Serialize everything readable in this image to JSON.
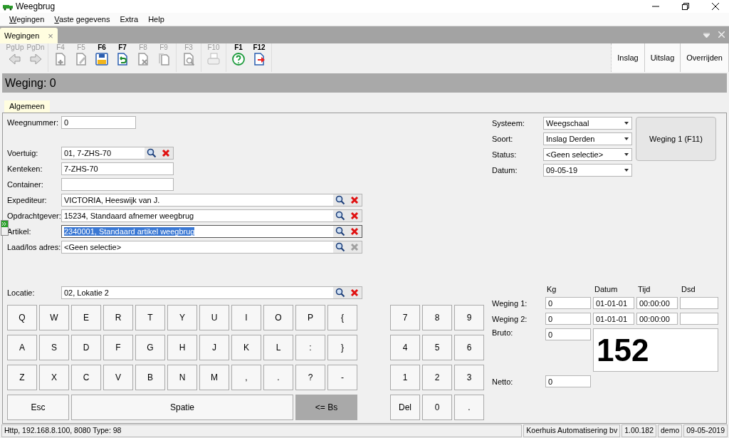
{
  "window": {
    "title": "Weegbrug"
  },
  "menu": [
    {
      "label": "Wegingen",
      "underline_first": true
    },
    {
      "label": "Vaste gegevens",
      "underline_first": true
    },
    {
      "label": "Extra",
      "underline_first": false
    },
    {
      "label": "Help",
      "underline_first": false
    }
  ],
  "document_tab": {
    "label": "Wegingen",
    "close": "×"
  },
  "toolbar": {
    "groups": [
      [
        {
          "key": "PgUp",
          "enabled": false
        },
        {
          "key": "PgDn",
          "enabled": false
        }
      ],
      [
        {
          "key": "F4",
          "enabled": false
        },
        {
          "key": "F5",
          "enabled": false
        },
        {
          "key": "F6",
          "enabled": true
        },
        {
          "key": "F7",
          "enabled": true
        },
        {
          "key": "F8",
          "enabled": false
        },
        {
          "key": "F9",
          "enabled": false
        }
      ],
      [
        {
          "key": "F3",
          "enabled": false
        }
      ],
      [
        {
          "key": "F10",
          "enabled": false
        }
      ],
      [
        {
          "key": "F1",
          "enabled": true
        },
        {
          "key": "F12",
          "enabled": true
        }
      ]
    ],
    "actions": [
      "Inslag",
      "Uitslag",
      "Overrijden"
    ]
  },
  "header": "Weging: 0",
  "tabs": [
    {
      "label": "Algemeen",
      "selected": true
    }
  ],
  "fields": [
    {
      "label": "Weegnummer:",
      "value": "0",
      "kind": "text"
    },
    {
      "label": "Voertuig:",
      "value": "01, 7-ZHS-70",
      "kind": "lookup",
      "clear_enabled": true,
      "selected": false
    },
    {
      "label": "Kenteken:",
      "value": "7-ZHS-70",
      "kind": "text"
    },
    {
      "label": "Container:",
      "kind": "text"
    },
    {
      "label": "Expediteur:",
      "value": "VICTORIA, Heeswijk van J.",
      "kind": "lookup",
      "clear_enabled": true,
      "selected": false
    },
    {
      "label": "Opdrachtgever:",
      "value": "15234, Standaard afnemer weegbrug",
      "kind": "lookup",
      "clear_enabled": true,
      "selected": false
    },
    {
      "label": "Artikel:",
      "value": "2340001, Standaard artikel weegbrug",
      "kind": "lookup",
      "clear_enabled": true,
      "selected": true
    },
    {
      "label": "Laad/los adres:",
      "value": "<Geen selectie>",
      "kind": "lookup",
      "clear_enabled": false,
      "selected": false
    }
  ],
  "location_field": {
    "label": "Locatie:",
    "value": "02, Lokatie 2",
    "clear_enabled": true,
    "selected": false
  },
  "keyboard": {
    "letter_rows": [
      [
        "Q",
        "W",
        "E",
        "R",
        "T",
        "Y",
        "U",
        "I",
        "O",
        "P",
        "{"
      ],
      [
        "A",
        "S",
        "D",
        "F",
        "G",
        "H",
        "J",
        "K",
        "L",
        ":",
        "}"
      ],
      [
        "Z",
        "X",
        "C",
        "V",
        "B",
        "N",
        "M",
        ",",
        ".",
        "?",
        "-"
      ]
    ],
    "bottom_row": [
      {
        "label": "Esc",
        "pressed": false
      },
      {
        "label": "Spatie",
        "pressed": false
      },
      {
        "label": "<= Bs",
        "pressed": true
      }
    ],
    "numpad": [
      [
        "7",
        "8",
        "9"
      ],
      [
        "4",
        "5",
        "6"
      ],
      [
        "1",
        "2",
        "3"
      ],
      [
        "Del",
        "0",
        "."
      ]
    ]
  },
  "settings": [
    {
      "label": "Systeem:",
      "value": "Weegschaal"
    },
    {
      "label": "Soort:",
      "value": "Inslag Derden"
    },
    {
      "label": "Status:",
      "value": "<Geen selectie>"
    },
    {
      "label": "Datum:",
      "value": "09-05-19"
    }
  ],
  "weigh_button": "Weging 1 (F11)",
  "weights": {
    "columns": [
      "Kg",
      "Datum",
      "Tijd",
      "Dsd"
    ],
    "rows": [
      {
        "label": "Weging 1:",
        "values": [
          "0",
          "01-01-01",
          "00:00:00"
        ]
      },
      {
        "label": "Weging 2:",
        "values": [
          "0",
          "01-01-01",
          "00:00:00"
        ]
      }
    ],
    "bruto": {
      "label": "Bruto:",
      "value": "0"
    },
    "display": "152",
    "netto": {
      "label": "Netto:",
      "value": "0"
    }
  },
  "status_bar": [
    "Http, 192.168.8.100, 8080 Type: 98",
    "Koerhuis Automatisering bv",
    "1.00.182",
    "demo",
    "09-05-2019"
  ]
}
